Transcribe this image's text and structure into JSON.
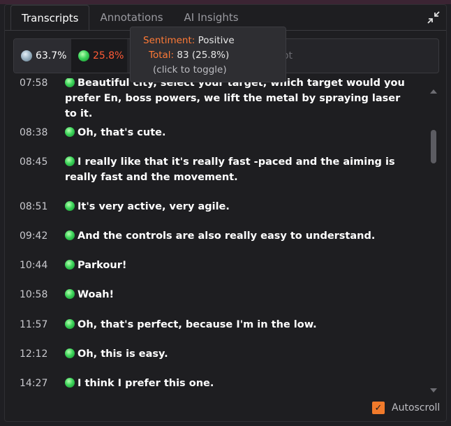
{
  "tabs": {
    "transcripts": "Transcripts",
    "annotations": "Annotations",
    "ai_insights": "AI Insights"
  },
  "filters": {
    "neutral_pct": "63.7%",
    "positive_pct": "25.8%",
    "transcript_partial": "ript"
  },
  "tooltip": {
    "sentiment_label": "Sentiment:",
    "sentiment_value": "Positive",
    "total_label": "Total:",
    "total_value": "83 (25.8%)",
    "hint": "(click to toggle)"
  },
  "transcript": [
    {
      "time": "07:58",
      "text": "Beautiful city, select your target, which target would you prefer En, boss powers, we lift the metal by spraying laser to it."
    },
    {
      "time": "08:38",
      "text": "Oh, that's cute."
    },
    {
      "time": "08:45",
      "text": "I really like that it's really fast -paced and the aiming is really fast and the movement."
    },
    {
      "time": "08:51",
      "text": "It's very active, very agile."
    },
    {
      "time": "09:42",
      "text": "And the controls are also really easy to understand."
    },
    {
      "time": "10:44",
      "text": "Parkour!"
    },
    {
      "time": "10:58",
      "text": "Woah!"
    },
    {
      "time": "11:57",
      "text": "Oh, that's perfect, because I'm in the low."
    },
    {
      "time": "12:12",
      "text": "Oh, this is easy."
    },
    {
      "time": "14:27",
      "text": "I think I prefer this one."
    }
  ],
  "autoscroll": {
    "label": "Autoscroll",
    "checked": true
  },
  "colors": {
    "accent": "#f07a2b",
    "positive": "#ff5a36",
    "background": "#1e1e21"
  }
}
